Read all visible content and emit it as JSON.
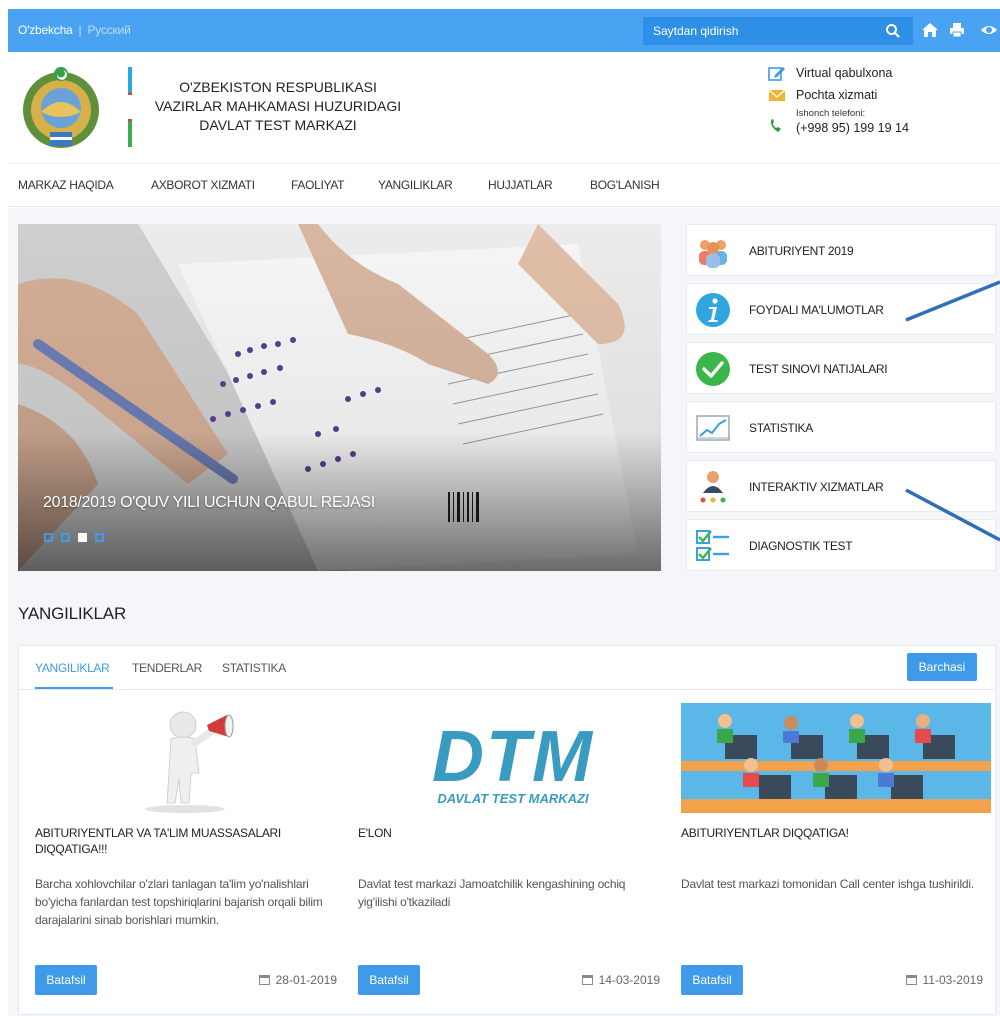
{
  "topbar": {
    "lang_uz": "O'zbekcha",
    "lang_sep": "|",
    "lang_ru": "Русский",
    "search_placeholder": "Saytdan qidirish"
  },
  "header": {
    "org_line1": "O'ZBEKISTON RESPUBLIKASI",
    "org_line2": "VAZIRLAR MAHKAMASI HUZURIDAGI",
    "org_line3": "DAVLAT TEST MARKAZI",
    "virtual": "Virtual qabulxona",
    "mail": "Pochta xizmati",
    "phone_label": "Ishonch telefoni:",
    "phone": "(+998 95) 199 19 14"
  },
  "nav": [
    "MARKAZ HAQIDA",
    "AXBOROT XIZMATI",
    "FAOLIYAT",
    "YANGILIKLAR",
    "HUJJATLAR",
    "BOG'LANISH"
  ],
  "slider": {
    "title": "2018/2019 O'QUV YILI UCHUN QABUL REJASI",
    "active_index": 2,
    "count": 4
  },
  "side": [
    {
      "label": "ABITURIYENT 2019",
      "icon": "people-icon"
    },
    {
      "label": "FOYDALI MA'LUMOTLAR",
      "icon": "info-icon"
    },
    {
      "label": "TEST SINOVI NATIJALARI",
      "icon": "checkmark-icon"
    },
    {
      "label": "STATISTIKA",
      "icon": "chart-icon"
    },
    {
      "label": "INTERAKTIV XIZMATLAR",
      "icon": "person-network-icon"
    },
    {
      "label": "DIAGNOSTIK TEST",
      "icon": "checklist-icon"
    }
  ],
  "news": {
    "section_title": "YANGILIKLAR",
    "tabs": [
      "YANGILIKLAR",
      "TENDERLAR",
      "STATISTIKA"
    ],
    "all_label": "Barchasi",
    "more_label": "Batafsil",
    "cards": [
      {
        "title": "ABITURIYENTLAR VA TA'LIM MUASSASALARI DIQQATIGA!!!",
        "desc": "Barcha xohlovchilar o'zlari tanlagan ta'lim yo'nalishlari bo'yicha fanlardan test topshiriqlarini bajarish orqali bilim darajalarini sinab borishlari mumkin.",
        "date": "28-01-2019"
      },
      {
        "title": "E'LON",
        "desc": "Davlat test markazi Jamoatchilik kengashining ochiq yig'ilishi o'tkaziladi",
        "date": "14-03-2019"
      },
      {
        "title": "ABITURIYENTLAR DIQQATIGA!",
        "desc": "Davlat test markazi tomonidan Call center ishga tushirildi.",
        "date": "11-03-2019"
      }
    ],
    "logo_text": "DTM",
    "logo_sub": "DAVLAT TEST MARKAZI"
  },
  "colors": {
    "accent": "#3f9bea",
    "topbar": "#4aa3f2"
  }
}
